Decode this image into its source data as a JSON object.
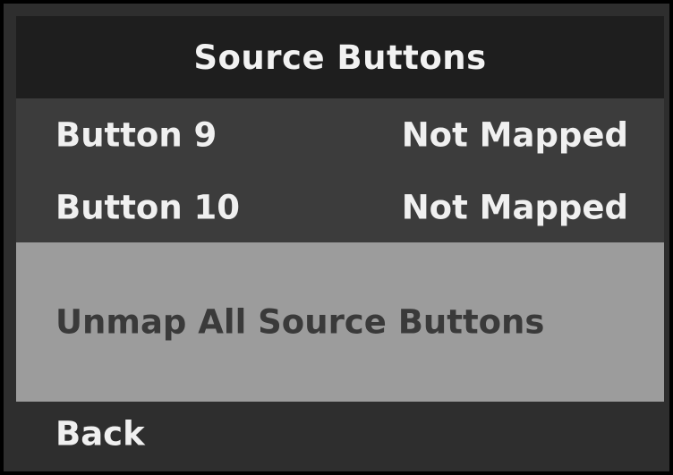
{
  "header": {
    "title": "Source Buttons"
  },
  "menu": {
    "items": [
      {
        "label": "Button 9",
        "value": "Not Mapped"
      },
      {
        "label": "Button 10",
        "value": "Not Mapped"
      }
    ],
    "unmap_all_label": "Unmap All Source Buttons",
    "back_label": "Back",
    "selected_item": "Unmap All Source Buttons"
  },
  "colors": {
    "header_bg": "#1e1e1e",
    "row_bg": "#3c3c3c",
    "selected_bg": "#9c9c9c",
    "selected_text": "#3a3a3a",
    "text": "#f0f0f0",
    "frame": "#000000"
  }
}
